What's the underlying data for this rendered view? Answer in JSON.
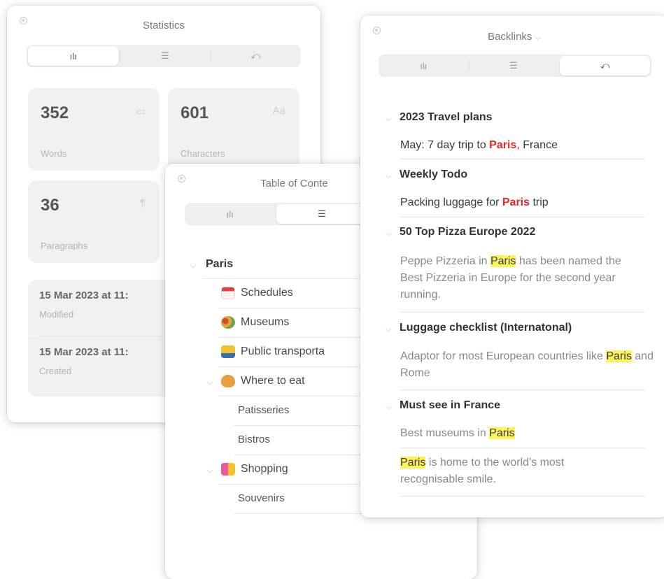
{
  "statistics": {
    "title": "Statistics",
    "cards": [
      {
        "value": "352",
        "label": "Words",
        "icon": "speech-bubble-icon"
      },
      {
        "value": "601",
        "label": "Characters",
        "icon": "Aa"
      },
      {
        "value": "36",
        "label": "Paragraphs",
        "icon": "¶"
      }
    ],
    "modified": {
      "value": "15 Mar 2023 at 11:",
      "label": "Modified"
    },
    "created": {
      "value": "15 Mar 2023 at 11:",
      "label": "Created"
    }
  },
  "toc": {
    "title": "Table of Conte",
    "root": "Paris",
    "items": {
      "schedules": "Schedules",
      "museums": "Museums",
      "transport": "Public transporta",
      "eat": "Where to eat",
      "patisseries": "Patisseries",
      "bistros": "Bistros",
      "shopping": "Shopping",
      "souvenirs": "Souvenirs"
    }
  },
  "backlinks": {
    "title": "Backlinks",
    "groups": [
      {
        "heading": "2023 Travel plans",
        "before": "May: 7 day trip to ",
        "match": "Paris",
        "after": ", France"
      },
      {
        "heading": "Weekly Todo",
        "before": "Packing luggage for ",
        "match": "Paris",
        "after": " trip"
      },
      {
        "heading": "50 Top Pizza Europe 2022",
        "before": "Peppe Pizzeria in ",
        "match": "Paris",
        "after": " has been named the Best Pizzeria in Europe for the second year running."
      },
      {
        "heading": "Luggage checklist (Internatonal)",
        "before": "Adaptor for most European countries like ",
        "match": "Paris",
        "after": " and Rome"
      },
      {
        "heading": "Must see in France",
        "before": "Best museums in ",
        "match": "Paris",
        "after": ""
      }
    ],
    "last": {
      "match": "Paris",
      "after": " is home to the world's most recognisable smile."
    }
  },
  "colors": {
    "match_red": "#e02828",
    "highlight": "#fff35c"
  }
}
